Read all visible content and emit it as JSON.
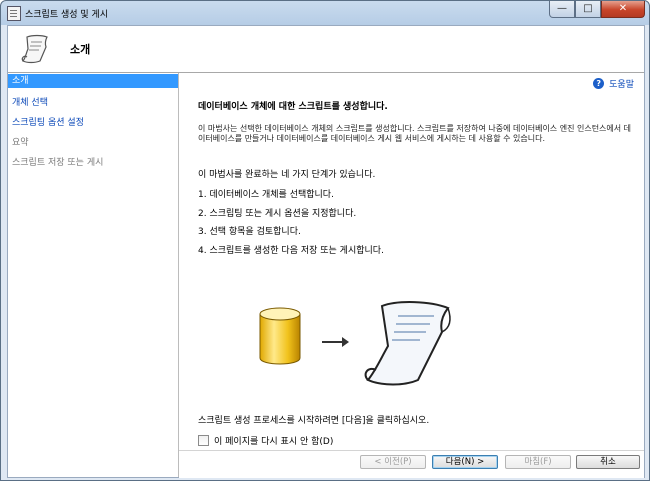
{
  "window": {
    "title": "스크립트 생성 및 게시",
    "min_label": "—",
    "max_label": "□",
    "close_label": "✕"
  },
  "header": {
    "title": "소개"
  },
  "sidebar": {
    "items": [
      {
        "label": "소개",
        "state": "selected"
      },
      {
        "label": "개체 선택",
        "state": "link"
      },
      {
        "label": "스크립팅 옵션 설정",
        "state": "link"
      },
      {
        "label": "요약",
        "state": "disabled"
      },
      {
        "label": "스크립트 저장 또는 게시",
        "state": "disabled"
      }
    ]
  },
  "main": {
    "help_label": "도움말",
    "heading": "데이터베이스 개체에 대한 스크립트를 생성합니다.",
    "description": "이 마법사는 선택한 데이터베이스 개체의 스크립트를 생성합니다. 스크립트를 저장하여 나중에 데이터베이스 엔진 인스턴스에서 데이터베이스를 만들거나 데이터베이스를 데이터베이스 게시 웹 서비스에 게시하는 데 사용할 수 있습니다.",
    "steps_intro": "이 마법사를 완료하는 네 가지 단계가 있습니다.",
    "steps": [
      "1. 데이터베이스 개체를 선택합니다.",
      "2. 스크립팅 또는 게시 옵션을 지정합니다.",
      "3. 선택 항목을 검토합니다.",
      "4. 스크립트를 생성한 다음 저장 또는 게시합니다."
    ],
    "footer_text": "스크립트 생성 프로세스를 시작하려면 [다음]을 클릭하십시오.",
    "checkbox_label": "이 페이지를 다시 표시 안 함(D)",
    "checkbox_checked": false
  },
  "buttons": {
    "prev": "< 이전(P)",
    "next": "다음(N) >",
    "finish": "마침(F)",
    "cancel": "취소"
  },
  "icons": {
    "title": "script-icon",
    "header": "scroll-icon",
    "help": "help-icon",
    "database": "database-icon",
    "arrow": "arrow-icon",
    "scroll": "script-scroll-icon"
  },
  "colors": {
    "selected_bg": "#3399ff",
    "link": "#0b48b8",
    "disabled": "#7a7a7a"
  }
}
